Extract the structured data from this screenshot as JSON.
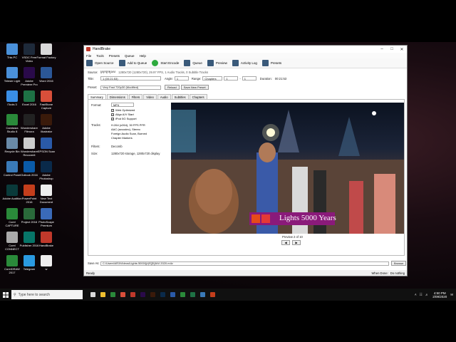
{
  "desktop": {
    "icons": [
      {
        "label": "This PC",
        "color": "#4a90d9"
      },
      {
        "label": "VSDC Free Video",
        "color": "#1e2a3a"
      },
      {
        "label": "Format Factory",
        "color": "#d9d9d9"
      },
      {
        "label": "Teleste Light",
        "color": "#4a8fd9"
      },
      {
        "label": "Adobe Premiere Pro",
        "color": "#2a0a4a"
      },
      {
        "label": "Word 2016",
        "color": "#2b5797"
      },
      {
        "label": "iTools 3",
        "color": "#3a8ee6"
      },
      {
        "label": "Excel 2016",
        "color": "#1e7145"
      },
      {
        "label": "FastStone Capture",
        "color": "#d94f3a"
      },
      {
        "label": "Camtasia Studio 8",
        "color": "#2a8a3a"
      },
      {
        "label": "Wondershare Filmora",
        "color": "#222222"
      },
      {
        "label": "Adobe Illustrator",
        "color": "#3a1a0a"
      },
      {
        "label": "Recycle Bin",
        "color": "#6a8aa8"
      },
      {
        "label": "Wondershare Recoverit",
        "color": "#cccccc"
      },
      {
        "label": "EPSON Scan",
        "color": "#2a5aa8"
      },
      {
        "label": "Control Panel",
        "color": "#3a7ab8"
      },
      {
        "label": "Outlook 2016",
        "color": "#0a5aa8"
      },
      {
        "label": "Adobe Photoshop",
        "color": "#0a2a4a"
      },
      {
        "label": "Adobe Audition",
        "color": "#0a3a3a"
      },
      {
        "label": "PowerPoint 2016",
        "color": "#c43e1c"
      },
      {
        "label": "New Text Document",
        "color": "#eeeeee"
      },
      {
        "label": "Corel CAPTURE",
        "color": "#2a8a3a"
      },
      {
        "label": "Project 2016",
        "color": "#2a6a3a"
      },
      {
        "label": "PhotoScape Premium",
        "color": "#3a6ab8"
      },
      {
        "label": "Corel CONNECT",
        "color": "#aaaaaa"
      },
      {
        "label": "Publisher 2016",
        "color": "#077568"
      },
      {
        "label": "HandBrake",
        "color": "#c0392b"
      },
      {
        "label": "CorelDRAW 2017",
        "color": "#2a8a3a"
      },
      {
        "label": "Telegram",
        "color": "#2a9ae0"
      },
      {
        "label": "w",
        "color": "#eeeeee"
      }
    ]
  },
  "window": {
    "title": "HandBrake",
    "menu": [
      "File",
      "Tools",
      "Presets",
      "Queue",
      "Help"
    ],
    "toolbar": [
      {
        "label": "Open Source",
        "icon": "film-icon",
        "color": "#3a5a7a"
      },
      {
        "label": "Add to Queue",
        "icon": "queue-add-icon",
        "color": "#3a5a7a"
      },
      {
        "label": "Start Encode",
        "icon": "play-icon",
        "color": "#2eaa3e"
      },
      {
        "label": "Queue",
        "icon": "queue-icon",
        "color": "#3a5a7a"
      },
      {
        "label": "Preview",
        "icon": "preview-icon",
        "color": "#3a5a7a"
      },
      {
        "label": "Activity Log",
        "icon": "log-icon",
        "color": "#3a5a7a"
      },
      {
        "label": "Presets",
        "icon": "presets-icon",
        "color": "#3a5a7a"
      }
    ],
    "source": {
      "label": "Source:",
      "name": "ស្រុកក្រមួនស",
      "info": "1280x720 (1280x720), 29.97 FPS, 1 Audio Tracks, 0 Subtitle Tracks"
    },
    "title_row": {
      "title_label": "Title:",
      "title_value": "1 (00:21:53)",
      "angle_label": "Angle:",
      "angle_value": "1",
      "range_label": "Range:",
      "range_value": "Chapters",
      "range_from": "1",
      "range_to": "1",
      "duration_label": "Duration:",
      "duration_value": "00:21:53"
    },
    "presets_row": {
      "label": "Preset:",
      "value": "Very Fast 720p30 (Modified)",
      "reload": "Reload",
      "save": "Save New Preset"
    },
    "tabs": [
      "Summary",
      "Dimensions",
      "Filters",
      "Video",
      "Audio",
      "Subtitles",
      "Chapters"
    ],
    "summary": {
      "format_label": "Format:",
      "format_value": "MP4",
      "checks": [
        "Web Optimized",
        "Align A/V Start",
        "iPod 5G Support"
      ],
      "tracks_label": "Tracks:",
      "tracks": [
        "H.264 (x264), 30 FPS PFR",
        "AAC (avcodec), Stereo",
        "Foreign Audio Scan, Burned",
        "Chapter Markers"
      ],
      "filters_label": "Filters:",
      "filters_value": "Decomb",
      "size_label": "Size:",
      "size_value": "1280x720 storage, 1280x720 display",
      "preview_caption": "Preview 2 of 10",
      "watermark": "Lights 5000 Years"
    },
    "save_as": {
      "label": "Save As:",
      "value": "C:\\Users\\MSI\\Videos\\Lights 5000\\ស្រុកក្រមួនស 2020.m4v",
      "browse": "Browse"
    },
    "status": {
      "left": "Ready",
      "when_done_label": "When Done:",
      "when_done_value": "Do nothing"
    }
  },
  "taskbar": {
    "search_placeholder": "Type here to search",
    "apps": [
      "#d9d9d9",
      "#f0c030",
      "#2a8a3a",
      "#d94f3a",
      "#c0392b",
      "#2a0a4a",
      "#3a1a0a",
      "#0a2a4a",
      "#2a5aa8",
      "#2a8a3a",
      "#1e7145",
      "#3a7ab8",
      "#c43e1c"
    ],
    "time": "4:50 PM",
    "date": "2/09/2020"
  }
}
